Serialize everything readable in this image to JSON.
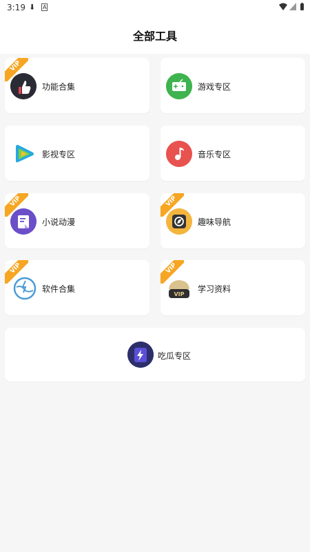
{
  "status_bar": {
    "time": "3:19"
  },
  "header": {
    "title": "全部工具"
  },
  "vip_tag": "VIP",
  "tiles": [
    {
      "label": "功能合集",
      "vip": true,
      "icon": "thumbs-up-icon"
    },
    {
      "label": "游戏专区",
      "vip": false,
      "icon": "gamepad-icon"
    },
    {
      "label": "影视专区",
      "vip": false,
      "icon": "video-play-icon"
    },
    {
      "label": "音乐专区",
      "vip": false,
      "icon": "music-note-icon"
    },
    {
      "label": "小说动漫",
      "vip": true,
      "icon": "book-icon"
    },
    {
      "label": "趣味导航",
      "vip": true,
      "icon": "compass-icon"
    },
    {
      "label": "软件合集",
      "vip": true,
      "icon": "lightning-globe-icon"
    },
    {
      "label": "学习资料",
      "vip": true,
      "icon": "vip-graduation-icon"
    },
    {
      "label": "吃瓜专区",
      "vip": false,
      "icon": "flash-photo-icon"
    }
  ],
  "colors": {
    "vip_ribbon": "#f6a623",
    "page_background": "#f6f6f6",
    "card_background": "#ffffff"
  }
}
